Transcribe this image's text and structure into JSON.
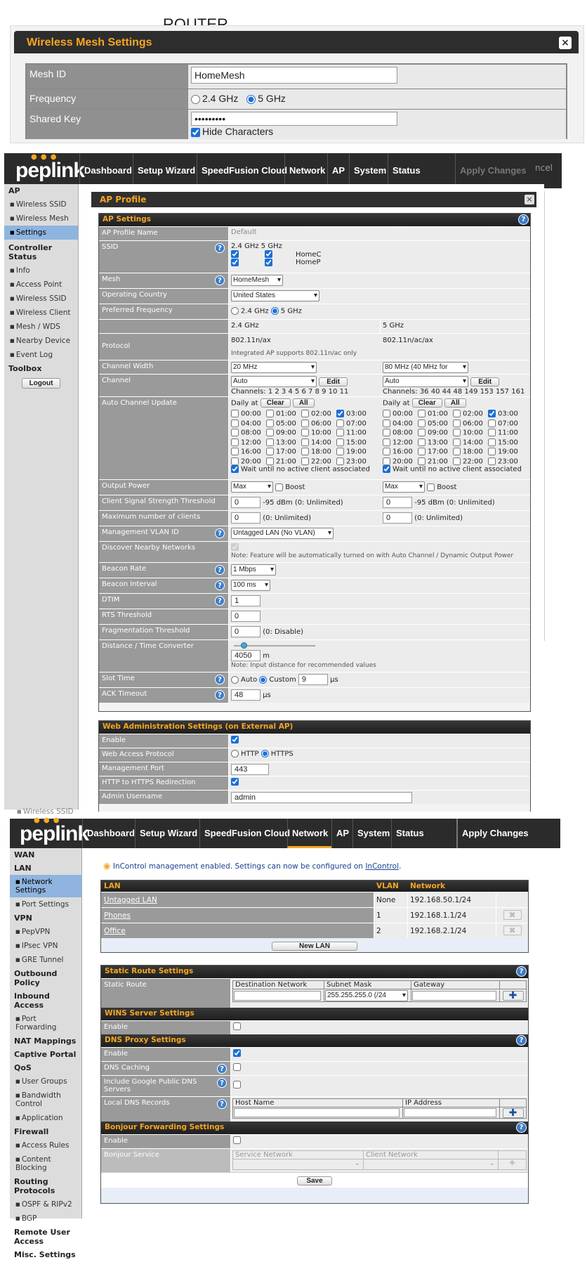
{
  "router": {
    "label": "ROUTER",
    "dialog_title": "Wireless Mesh Settings",
    "close_glyph": "×",
    "mesh_id_label": "Mesh ID",
    "mesh_id_value": "HomeMesh",
    "frequency_label": "Frequency",
    "freq_24": "2.4 GHz",
    "freq_5": "5 GHz",
    "shared_key_label": "Shared Key",
    "shared_key_value": "•••••••••",
    "hide_chars": "Hide Characters"
  },
  "nav1": {
    "logo": "peplink",
    "items": [
      "Dashboard",
      "Setup Wizard",
      "SpeedFusion Cloud",
      "Network",
      "AP",
      "System",
      "Status",
      "Apply Changes"
    ],
    "right_fragment": "ncel"
  },
  "sidebar1": {
    "head_ap": "AP",
    "ap_items": [
      "Wireless SSID",
      "Wireless Mesh",
      "Settings"
    ],
    "head_controller": "Controller Status",
    "controller_items": [
      "Info",
      "Access Point",
      "Wireless SSID",
      "Wireless Client",
      "Mesh / WDS",
      "Nearby Device",
      "Event Log"
    ],
    "head_toolbox": "Toolbox",
    "logout": "Logout",
    "bottom_fragment": "Wireless SSID"
  },
  "ap_profile": {
    "title": "AP Profile",
    "close_glyph": "×",
    "section_title": "AP Settings",
    "help_glyph": "?",
    "rows": {
      "profile_name_label": "AP Profile Name",
      "profile_name_value": "Default",
      "ssid_label": "SSID",
      "ssid_24": "2.4 GHz",
      "ssid_5": "5 GHz",
      "ssid_names": [
        "HomeC",
        "HomeP"
      ],
      "mesh_label": "Mesh",
      "mesh_value": "HomeMesh",
      "country_label": "Operating Country",
      "country_value": "United States",
      "pref_freq_label": "Preferred Frequency",
      "pref_24": "2.4 GHz",
      "pref_5": "5 GHz",
      "band_24": "2.4 GHz",
      "band_5": "5 GHz",
      "protocol_label": "Protocol",
      "protocol_24": "802.11n/ax",
      "protocol_5": "802.11n/ac/ax",
      "protocol_note": "Integrated AP supports 802.11n/ac only",
      "width_label": "Channel Width",
      "width_24": "20 MHz",
      "width_5": "80 MHz (40 MHz for",
      "channel_label": "Channel",
      "channel_24": "Auto",
      "channel_5": "Auto",
      "edit": "Edit",
      "channels_24": "Channels: 1 2 3 4 5 6 7 8 9 10 11",
      "channels_5": "Channels: 36 40 44 48 149 153 157 161",
      "acu_label": "Auto Channel Update",
      "daily_at": "Daily at",
      "clear": "Clear",
      "all": "All",
      "hours": [
        "00:00",
        "01:00",
        "02:00",
        "03:00",
        "04:00",
        "05:00",
        "06:00",
        "07:00",
        "08:00",
        "09:00",
        "10:00",
        "11:00",
        "12:00",
        "13:00",
        "14:00",
        "15:00",
        "16:00",
        "17:00",
        "18:00",
        "19:00",
        "20:00",
        "21:00",
        "22:00",
        "23:00"
      ],
      "wait": "Wait until no active client associated",
      "output_label": "Output Power",
      "output_value": "Max",
      "boost": "Boost",
      "signal_label": "Client Signal Strength Threshold",
      "signal_value": "0",
      "signal_unit": "-95 dBm (0: Unlimited)",
      "max_clients_label": "Maximum number of clients",
      "max_clients_value": "0",
      "max_clients_unit": "(0: Unlimited)",
      "vlan_label": "Management VLAN ID",
      "vlan_value": "Untagged LAN (No VLAN)",
      "discover_label": "Discover Nearby Networks",
      "discover_note": "Note: Feature will be automatically turned on with Auto Channel / Dynamic Output Power",
      "beacon_rate_label": "Beacon Rate",
      "beacon_rate_value": "1 Mbps",
      "beacon_int_label": "Beacon Interval",
      "beacon_int_value": "100 ms",
      "dtim_label": "DTIM",
      "dtim_value": "1",
      "rts_label": "RTS Threshold",
      "rts_value": "0",
      "frag_label": "Fragmentation Threshold",
      "frag_value": "0",
      "frag_unit": "(0: Disable)",
      "distance_label": "Distance / Time Converter",
      "distance_value": "4050",
      "distance_unit": "m",
      "distance_note": "Note: Input distance for recommended values",
      "slot_label": "Slot Time",
      "slot_auto": "Auto",
      "slot_custom": "Custom",
      "slot_value": "9",
      "slot_unit": "μs",
      "ack_label": "ACK Timeout",
      "ack_value": "48",
      "ack_unit": "μs"
    },
    "web": {
      "title": "Web Administration Settings (on External AP)",
      "enable_label": "Enable",
      "protocol_label": "Web Access Protocol",
      "http": "HTTP",
      "https": "HTTPS",
      "port_label": "Management Port",
      "port_value": "443",
      "redirect_label": "HTTP to HTTPS Redirection",
      "user_label": "Admin Username",
      "user_value": "admin"
    }
  },
  "nav2": {
    "logo": "peplink",
    "items": [
      "Dashboard",
      "Setup Wizard",
      "SpeedFusion Cloud",
      "Network",
      "AP",
      "System",
      "Status",
      "Apply Changes"
    ]
  },
  "sidebar2": {
    "groups": [
      {
        "head": "WAN",
        "items": []
      },
      {
        "head": "LAN",
        "items": [
          "Network Settings",
          "Port Settings"
        ]
      },
      {
        "head": "VPN",
        "items": [
          "PepVPN",
          "IPsec VPN",
          "GRE Tunnel"
        ]
      },
      {
        "head": "Outbound Policy",
        "items": []
      },
      {
        "head": "Inbound Access",
        "items": [
          "Port Forwarding"
        ]
      },
      {
        "head": "NAT Mappings",
        "items": []
      },
      {
        "head": "Captive Portal",
        "items": []
      },
      {
        "head": "QoS",
        "items": [
          "User Groups",
          "Bandwidth Control",
          "Application"
        ]
      },
      {
        "head": "Firewall",
        "items": [
          "Access Rules",
          "Content Blocking"
        ]
      },
      {
        "head": "Routing Protocols",
        "items": [
          "OSPF & RIPv2",
          "BGP"
        ]
      },
      {
        "head": "Remote User Access",
        "items": []
      },
      {
        "head": "Misc. Settings",
        "items": []
      }
    ]
  },
  "network": {
    "incontrol_text": "InControl management enabled. Settings can now be configured on ",
    "incontrol_link": "InControl",
    "incontrol_end": ".",
    "lan_headers": [
      "LAN",
      "VLAN",
      "Network"
    ],
    "lan_rows": [
      {
        "name": "Untagged LAN",
        "vlan": "None",
        "network": "192.168.50.1/24"
      },
      {
        "name": "Phones",
        "vlan": "1",
        "network": "192.168.1.1/24"
      },
      {
        "name": "Office",
        "vlan": "2",
        "network": "192.168.2.1/24"
      }
    ],
    "delete_glyph": "✖",
    "new_lan": "New LAN",
    "static_title": "Static Route Settings",
    "static_label": "Static Route",
    "static_cols": [
      "Destination Network",
      "Subnet Mask",
      "Gateway"
    ],
    "subnet_value": "255.255.255.0 (/24",
    "plus_glyph": "✚",
    "wins_title": "WINS Server Settings",
    "enable_label": "Enable",
    "dns_title": "DNS Proxy Settings",
    "dns_caching": "DNS Caching",
    "google_dns": "Include Google Public DNS Servers",
    "local_dns": "Local DNS Records",
    "dns_cols": [
      "Host Name",
      "IP Address"
    ],
    "bonjour_title": "Bonjour Forwarding Settings",
    "bonjour_service": "Bonjour Service",
    "bonjour_cols": [
      "Service Network",
      "Client Network"
    ],
    "save": "Save",
    "help_glyph": "?"
  }
}
